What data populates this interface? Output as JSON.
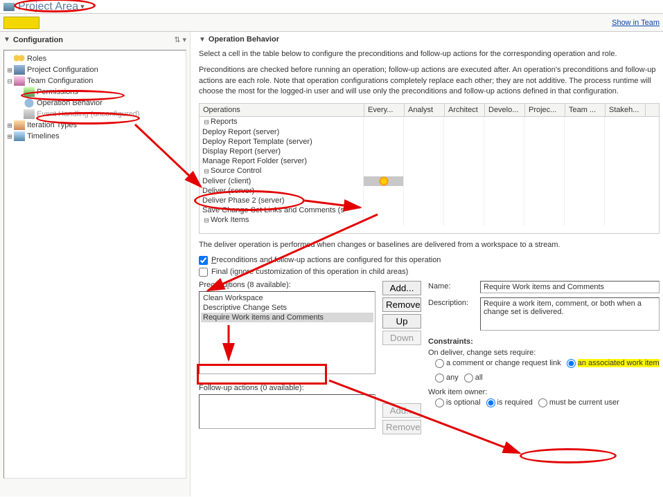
{
  "titlebar": {
    "title": "Project Area"
  },
  "toolbar": {
    "show_link": "Show in Team"
  },
  "config_panel": {
    "title": "Configuration",
    "tree": {
      "roles": "Roles",
      "project_conf": "Project Configuration",
      "team_conf": "Team Configuration",
      "permissions": "Permissions",
      "op_behavior": "Operation Behavior",
      "event_handling": "Event Handling (unconfigured)",
      "iter_types": "Iteration Types",
      "timelines": "Timelines"
    }
  },
  "op_panel": {
    "title": "Operation Behavior",
    "desc1": "Select a cell in the table below to configure the preconditions and follow-up actions for the corresponding operation and role.",
    "desc2": "Preconditions are checked before running an operation; follow-up actions are executed after. An operation's preconditions and follow-up actions are each role. Note that operation configurations completely replace each other; they are not additive. The process runtime will choose the most for the logged-in user and will use only the preconditions and follow-up actions defined in that configuration.",
    "table": {
      "col_ops": "Operations",
      "col_every": "Every...",
      "col_analyst": "Analyst",
      "col_arch": "Architect",
      "col_dev": "Develo...",
      "col_proj": "Projec...",
      "col_team": "Team ...",
      "col_stake": "Stakeh...",
      "reports": "Reports",
      "dep_report": "Deploy Report (server)",
      "dep_tmpl": "Deploy Report Template (server)",
      "disp_report": "Display Report (server)",
      "manage_folder": "Manage Report Folder (server)",
      "src_ctrl": "Source Control",
      "deliver_client": "Deliver (client)",
      "deliver_server": "Deliver (server)",
      "deliver_p2": "Deliver Phase 2 (server)",
      "save_cs": "Save Change Set Links and Comments (s",
      "work_items": "Work Items"
    },
    "deliver_desc": "The deliver operation is performed when changes or baselines are delivered from a workspace to a stream.",
    "chk_preconditions": "Preconditions and follow-up actions are configured for this operation",
    "chk_final": "Final (ignore customization of this operation in child areas)",
    "preconditions_label": "Preconditions (8 available):",
    "prec_items": {
      "clean_ws": "Clean Workspace",
      "desc_cs": "Descriptive Change Sets",
      "req_wi": "Require Work items and Comments"
    },
    "btn_add": "Add...",
    "btn_remove": "Remove",
    "btn_up": "Up",
    "btn_down": "Down",
    "follow_label": "Follow-up actions (0 available):"
  },
  "detail": {
    "name_lbl": "Name:",
    "name_val": "Require Work items and Comments",
    "desc_lbl": "Description:",
    "desc_val": "Require a work item, comment, or both when a change set is delivered.",
    "constraints_lbl": "Constraints:",
    "on_deliver": "On deliver, change sets require:",
    "r_comment": "a comment or change request link",
    "r_assoc": "an associated work item",
    "r_any": "any",
    "r_all": "all",
    "wi_owner": "Work item owner:",
    "r_optional": "is optional",
    "r_required": "is required",
    "r_current": "must be current user"
  }
}
